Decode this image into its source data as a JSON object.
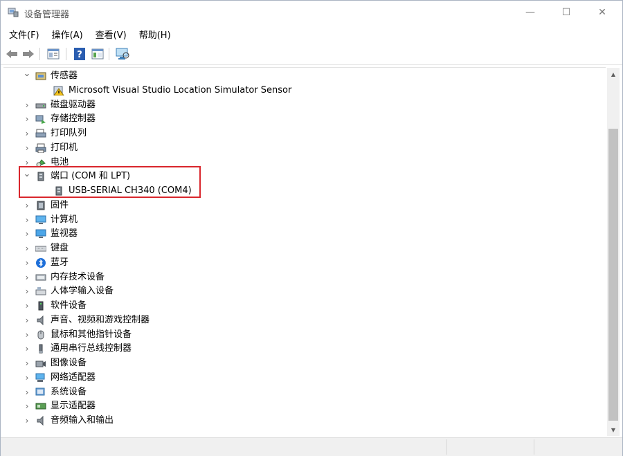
{
  "window": {
    "title": "设备管理器",
    "minimize_glyph": "—",
    "maximize_glyph": "☐",
    "close_glyph": "✕"
  },
  "menu": [
    "文件(F)",
    "操作(A)",
    "查看(V)",
    "帮助(H)"
  ],
  "toolbar": {
    "back_icon": "arrow-left-icon",
    "forward_icon": "arrow-right-icon",
    "properties_icon": "properties-icon",
    "help_icon": "help-icon",
    "view_icon": "view-icon",
    "monitor_icon": "scan-hardware-icon"
  },
  "tree": {
    "nodes": [
      {
        "label": "传感器",
        "expanded": true,
        "icon": "sensor-icon"
      },
      {
        "label": "Microsoft Visual Studio Location Simulator Sensor",
        "child": true,
        "icon": "warning-device-icon"
      },
      {
        "label": "磁盘驱动器",
        "expanded": false,
        "icon": "disk-drive-icon"
      },
      {
        "label": "存储控制器",
        "expanded": false,
        "icon": "storage-controller-icon"
      },
      {
        "label": "打印队列",
        "expanded": false,
        "icon": "print-queue-icon"
      },
      {
        "label": "打印机",
        "expanded": false,
        "icon": "printer-icon"
      },
      {
        "label": "电池",
        "expanded": false,
        "icon": "battery-icon"
      },
      {
        "label": "端口 (COM 和 LPT)",
        "expanded": true,
        "icon": "port-icon"
      },
      {
        "label": "USB-SERIAL CH340 (COM4)",
        "child": true,
        "icon": "port-device-icon"
      },
      {
        "label": "固件",
        "expanded": false,
        "icon": "firmware-icon"
      },
      {
        "label": "计算机",
        "expanded": false,
        "icon": "computer-icon"
      },
      {
        "label": "监视器",
        "expanded": false,
        "icon": "monitor-icon"
      },
      {
        "label": "键盘",
        "expanded": false,
        "icon": "keyboard-icon"
      },
      {
        "label": "蓝牙",
        "expanded": false,
        "icon": "bluetooth-icon"
      },
      {
        "label": "内存技术设备",
        "expanded": false,
        "icon": "memory-device-icon"
      },
      {
        "label": "人体学输入设备",
        "expanded": false,
        "icon": "hid-icon"
      },
      {
        "label": "软件设备",
        "expanded": false,
        "icon": "software-device-icon"
      },
      {
        "label": "声音、视频和游戏控制器",
        "expanded": false,
        "icon": "sound-icon"
      },
      {
        "label": "鼠标和其他指针设备",
        "expanded": false,
        "icon": "mouse-icon"
      },
      {
        "label": "通用串行总线控制器",
        "expanded": false,
        "icon": "usb-icon"
      },
      {
        "label": "图像设备",
        "expanded": false,
        "icon": "imaging-icon"
      },
      {
        "label": "网络适配器",
        "expanded": false,
        "icon": "network-adapter-icon"
      },
      {
        "label": "系统设备",
        "expanded": false,
        "icon": "system-device-icon"
      },
      {
        "label": "显示适配器",
        "expanded": false,
        "icon": "display-adapter-icon"
      },
      {
        "label": "音频输入和输出",
        "expanded": false,
        "icon": "audio-io-icon"
      }
    ]
  },
  "colors": {
    "highlight": "#d9262c",
    "accent_blue": "#1e6fd9"
  }
}
